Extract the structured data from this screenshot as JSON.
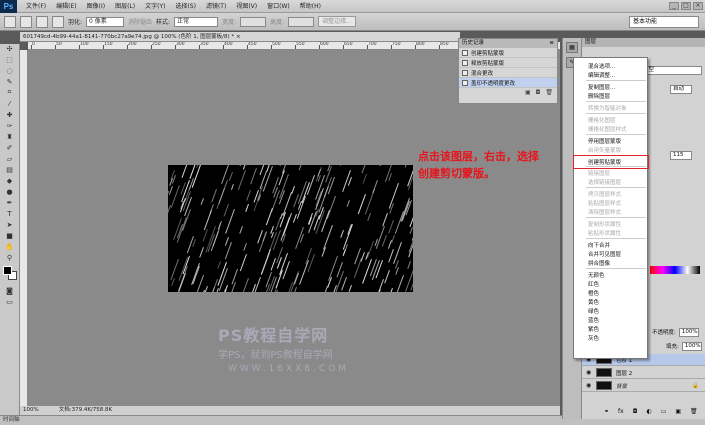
{
  "menubar": {
    "logo": "Ps",
    "items": [
      "文件(F)",
      "编辑(E)",
      "图像(I)",
      "图层(L)",
      "文字(Y)",
      "选择(S)",
      "滤镜(T)",
      "视图(V)",
      "窗口(W)",
      "帮助(H)"
    ]
  },
  "options": {
    "feather_label": "羽化:",
    "feather_value": "0 像素",
    "antialias_label": "消除锯齿",
    "style_label": "样式:",
    "style_value": "正常",
    "width_label": "宽度:",
    "height_label": "高度:",
    "refine_button": "调整边缘...",
    "workspace": "基本功能"
  },
  "document": {
    "tab": "601749cd-4b99-44a1-8141-770bc27a9e74.jpg @ 100% (色阶 1, 图层蒙板/8) *",
    "close": "×"
  },
  "ruler": [
    "0",
    "50",
    "100",
    "150",
    "200",
    "250",
    "300",
    "350",
    "400",
    "450",
    "500",
    "550",
    "600",
    "650",
    "700",
    "750",
    "800",
    "850",
    "900",
    "950",
    "1000",
    "1050"
  ],
  "annotation": [
    "点击该图层，右击，选择",
    "创建剪切蒙版。"
  ],
  "watermark": {
    "line1": "PS教程自学网",
    "line2": "学PS，就到PS教程自学网",
    "line3": "WWW.16XX8.COM"
  },
  "status": {
    "zoom": "100%",
    "doc": "文档:379.4K/758.8K"
  },
  "bottom": {
    "label": "时间轴"
  },
  "history": {
    "title": "历史记录",
    "items": [
      "创建剪贴蒙版",
      "释放剪贴蒙版",
      "混合更改",
      "盖印不透明度更改"
    ],
    "active": 3
  },
  "layers": {
    "tab": "图层",
    "kind": "类型",
    "opacity_label": "不透明度:",
    "opacity_value": "100%",
    "fill_label": "填充:",
    "fill_value": "100%",
    "extra_value": "115",
    "auto_button": "自动",
    "layer_names": [
      "色阶 1",
      "图层 2",
      "背景"
    ]
  },
  "context_menu": {
    "items": [
      {
        "label": "混合选项...",
        "enabled": true
      },
      {
        "label": "编辑调整...",
        "enabled": true
      },
      {
        "label": "复制图层...",
        "enabled": true
      },
      {
        "label": "删除图层",
        "enabled": true
      },
      {
        "label": "转换为智能对象",
        "enabled": false
      },
      {
        "label": "栅格化图层",
        "enabled": false
      },
      {
        "label": "栅格化图层样式",
        "enabled": false
      },
      {
        "label": "停用图层蒙版",
        "enabled": true
      },
      {
        "label": "启用矢量蒙版",
        "enabled": false
      },
      {
        "label": "创建剪贴蒙版",
        "enabled": true
      },
      {
        "label": "链接图层",
        "enabled": false
      },
      {
        "label": "选择链接图层",
        "enabled": false
      },
      {
        "label": "拷贝图层样式",
        "enabled": false
      },
      {
        "label": "粘贴图层样式",
        "enabled": false
      },
      {
        "label": "清除图层样式",
        "enabled": false
      },
      {
        "label": "复制形状属性",
        "enabled": false
      },
      {
        "label": "粘贴形状属性",
        "enabled": false
      },
      {
        "label": "向下合并",
        "enabled": true
      },
      {
        "label": "合并可见图层",
        "enabled": true
      },
      {
        "label": "拼合图像",
        "enabled": true
      },
      {
        "label": "无颜色",
        "enabled": true
      },
      {
        "label": "红色",
        "enabled": true
      },
      {
        "label": "橙色",
        "enabled": true
      },
      {
        "label": "黄色",
        "enabled": true
      },
      {
        "label": "绿色",
        "enabled": true
      },
      {
        "label": "蓝色",
        "enabled": true
      },
      {
        "label": "紫色",
        "enabled": true
      },
      {
        "label": "灰色",
        "enabled": true
      }
    ],
    "highlighted": "创建剪贴蒙版"
  },
  "colors": {
    "highlight": "#e0232a",
    "annotation": "#e8141c"
  }
}
